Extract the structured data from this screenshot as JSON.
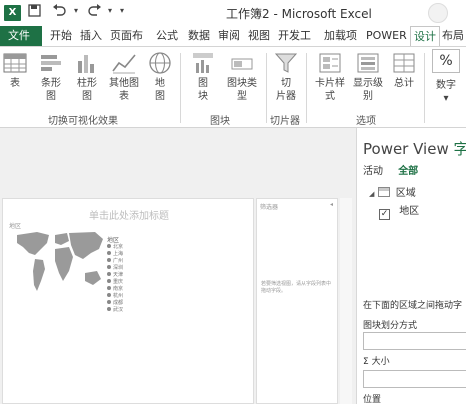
{
  "window": {
    "app_logo": "X",
    "title": "工作簿2 - Microsoft Excel"
  },
  "quick_access": {
    "save_icon": "save-icon",
    "undo_icon": "undo-icon",
    "redo_icon": "redo-icon"
  },
  "tabs": {
    "file": "文件",
    "home": "开始",
    "insert": "插入",
    "page_layout": "页面布",
    "formulas": "公式",
    "data": "数据",
    "review": "审阅",
    "view": "视图",
    "developer": "开发工",
    "addins": "加载项",
    "power": "POWER",
    "design": "设计",
    "layout": "布局"
  },
  "ribbon": {
    "table": "表",
    "bar_chart_1": "条形",
    "bar_chart_2": "图",
    "column_chart_1": "柱形",
    "column_chart_2": "图",
    "other_chart_1": "其他图",
    "other_chart_2": "表",
    "map_1": "地",
    "map_2": "图",
    "group_switch_viz": "切换可视化效果",
    "tile_1": "图",
    "tile_2": "块",
    "tile_type_1": "图块类",
    "tile_type_2": "型",
    "group_tiles": "图块",
    "slicer_1": "切",
    "slicer_2": "片器",
    "group_slicer": "切片器",
    "card_style_1": "卡片样",
    "card_style_2": "式",
    "show_level_1": "显示级",
    "show_level_2": "别",
    "total_1": "总计",
    "group_options": "选项",
    "number_symbol": "%",
    "number": "数字"
  },
  "canvas": {
    "title_placeholder": "单击此处添加标题",
    "map_caption": "地区",
    "legend_title": "地区",
    "legend_items": [
      "北京",
      "上海",
      "广州",
      "深圳",
      "天津",
      "重庆",
      "南京",
      "杭州",
      "成都",
      "武汉"
    ],
    "filter_title": "筛选器",
    "filter_hint": "若要筛选视图，请从字段列表中拖动字段。"
  },
  "field_list": {
    "title_main": "Power View ",
    "title_accent": "字",
    "tab_active": "活动",
    "tab_all": "全部",
    "table_name": "区域",
    "field_name": "地区",
    "field_checked": "✓",
    "drag_hint": "在下面的区域之间拖动字",
    "tile_by": "图块划分方式",
    "size_symbol": "Σ",
    "size": "大小",
    "location": "位置"
  },
  "colors": {
    "excel_green": "#1e7145",
    "map_gray": "#9a9a9a"
  }
}
